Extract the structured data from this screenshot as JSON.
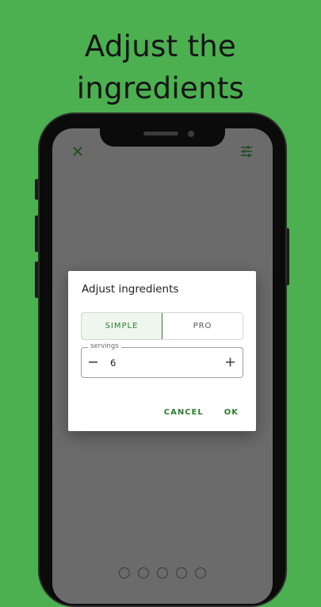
{
  "headline": {
    "line1": "Adjust the",
    "line2": "ingredients"
  },
  "toolbar": {
    "close_icon": "close-icon",
    "tune_icon": "tune-icon"
  },
  "dialog": {
    "title": "Adjust ingredients",
    "segments": {
      "simple": "SIMPLE",
      "pro": "PRO",
      "selected": "SIMPLE"
    },
    "servings": {
      "label": "servings",
      "value": "6"
    },
    "actions": {
      "cancel": "CANCEL",
      "ok": "OK"
    }
  },
  "colors": {
    "background": "#4caf50",
    "accent": "#2e7d32",
    "scrim": "#6b6b6b"
  }
}
